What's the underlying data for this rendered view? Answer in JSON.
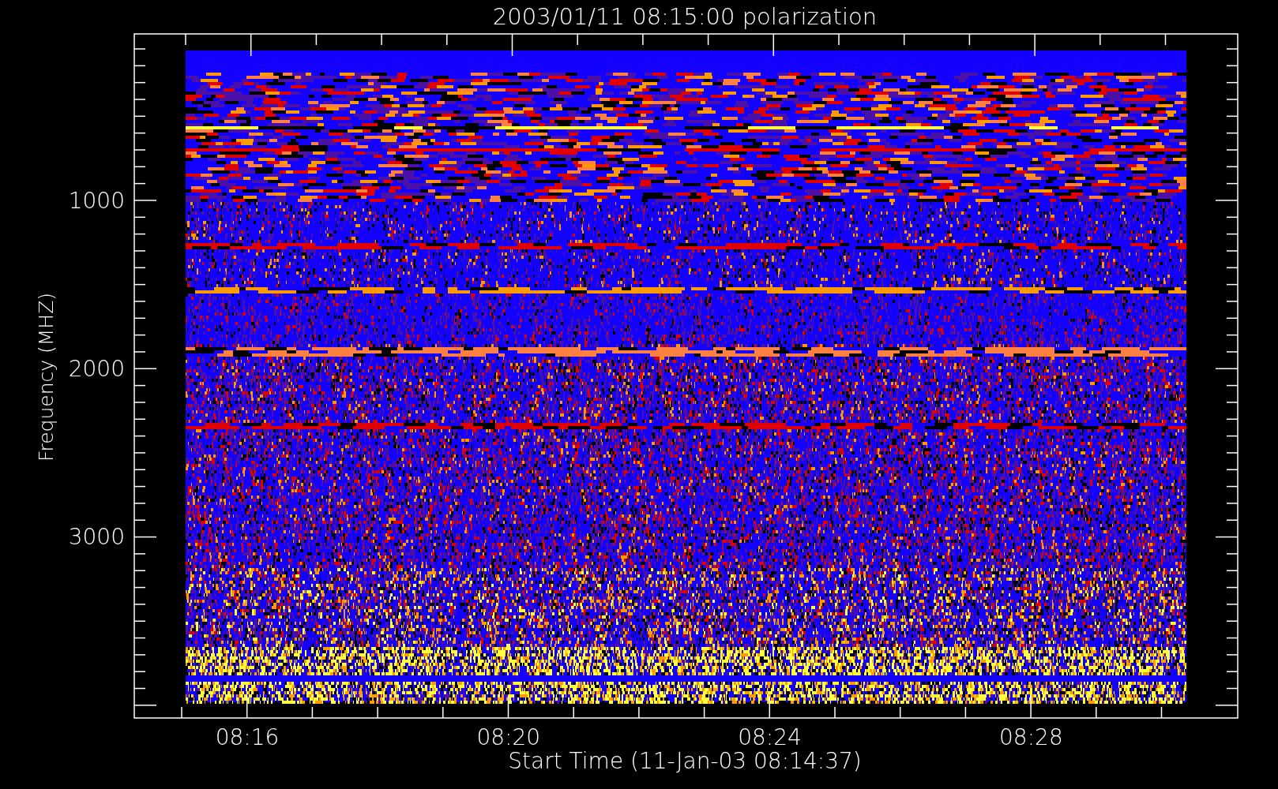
{
  "title": "2003/01/11 08:15:00 polarization",
  "y_axis": {
    "label": "Frequency (MHZ)",
    "tick_labels": [
      "1000",
      "2000",
      "3000"
    ]
  },
  "x_axis": {
    "label": "Start Time (11-Jan-03 08:14:37)",
    "tick_labels": [
      "08:16",
      "08:20",
      "08:24",
      "08:28"
    ]
  }
}
